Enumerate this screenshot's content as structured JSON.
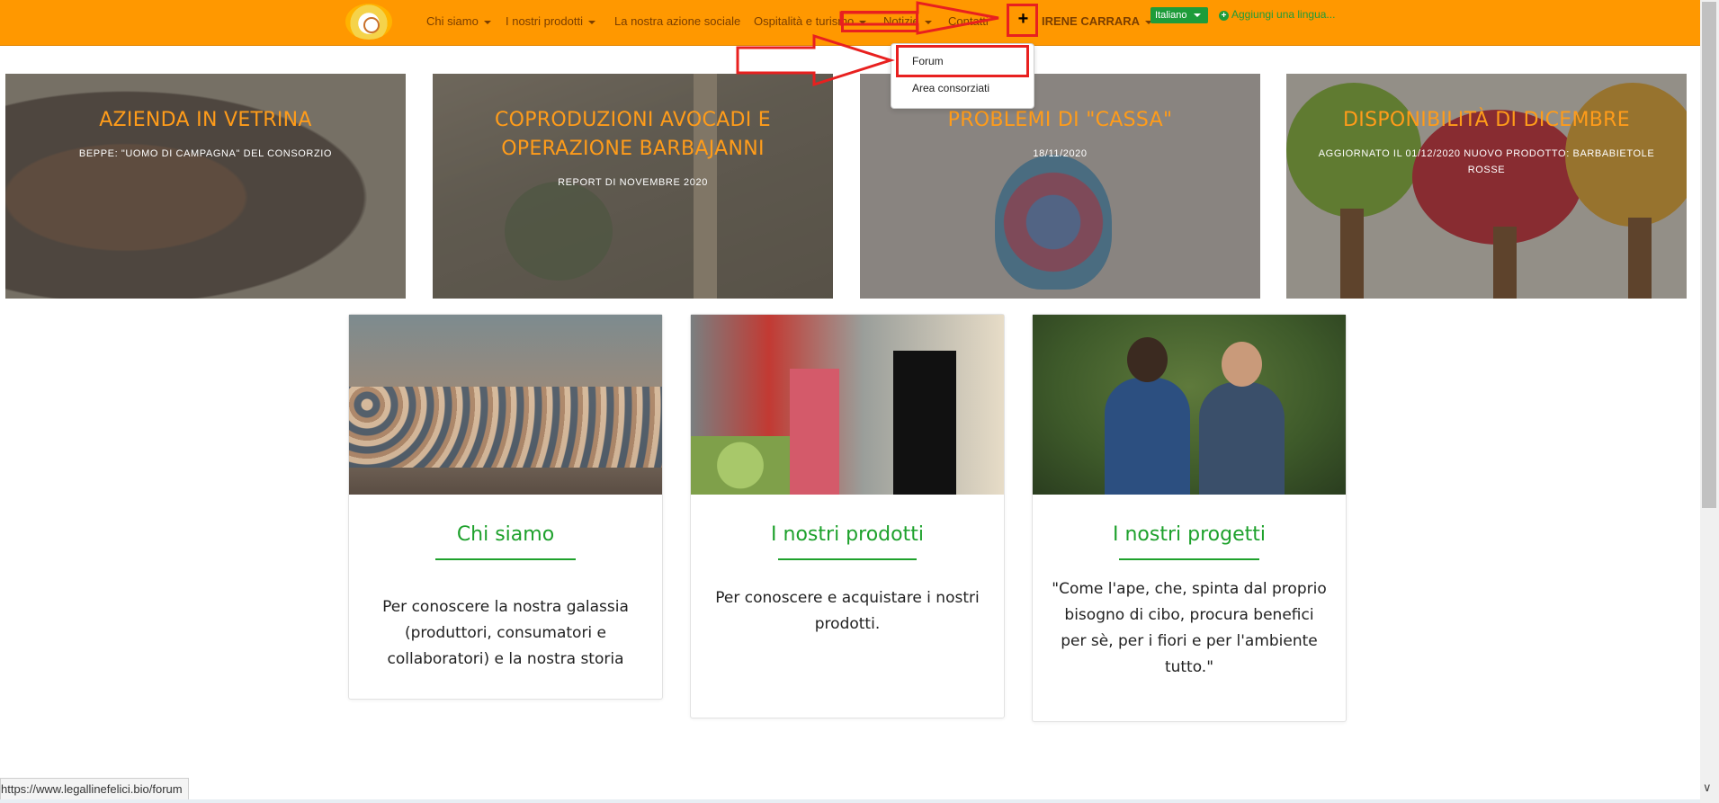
{
  "navbar": {
    "logo_alt": "Le Galline Felici logo",
    "items": [
      {
        "label": "Chi siamo",
        "has_caret": true
      },
      {
        "label": "I nostri prodotti",
        "has_caret": true
      },
      {
        "label": "La nostra azione sociale",
        "has_caret": false
      },
      {
        "label": "Ospitalità e turismo",
        "has_caret": true
      },
      {
        "label": "Notizie",
        "has_caret": true
      },
      {
        "label": "Contatti",
        "has_caret": false
      }
    ],
    "plus_label": "+",
    "user_name": "IRENE CARRARA",
    "language": "Italiano",
    "add_language": "Aggiungi una lingua..."
  },
  "dropdown": {
    "items": [
      "Forum",
      "Area consorziati"
    ]
  },
  "hero_cards": [
    {
      "title": "AZIENDA IN VETRINA",
      "subtitle": "BEPPE: \"UOMO DI CAMPAGNA\" DEL CONSORZIO"
    },
    {
      "title": "COPRODUZIONI AVOCADI E OPERAZIONE BARBAJANNI",
      "subtitle": "REPORT DI NOVEMBRE 2020"
    },
    {
      "title": "PROBLEMI DI \"CASSA\"",
      "subtitle": "18/11/2020"
    },
    {
      "title": "DISPONIBILITÀ DI DICEMBRE",
      "subtitle": "AGGIORNATO IL 01/12/2020 NUOVO PRODOTTO: BARBABIETOLE ROSSE"
    }
  ],
  "feature_cards": [
    {
      "title": "Chi siamo",
      "text": "Per conoscere la nostra galassia (produttori, consumatori e collaboratori) e la nostra storia"
    },
    {
      "title": "I nostri prodotti",
      "text": "Per conoscere e acquistare i nostri prodotti."
    },
    {
      "title": "I nostri progetti",
      "text": "\"Come l'ape, che, spinta dal proprio bisogno di cibo, procura benefici per sè, per i fiori e per l'ambiente tutto.\""
    }
  ],
  "status_bar": {
    "url": "https://www.legallinefelici.bio/forum"
  },
  "colors": {
    "navbar": "#ff9800",
    "accent_green": "#1ea12c",
    "hero_title": "#ff9c1a",
    "annotation_red": "#e8201f"
  }
}
